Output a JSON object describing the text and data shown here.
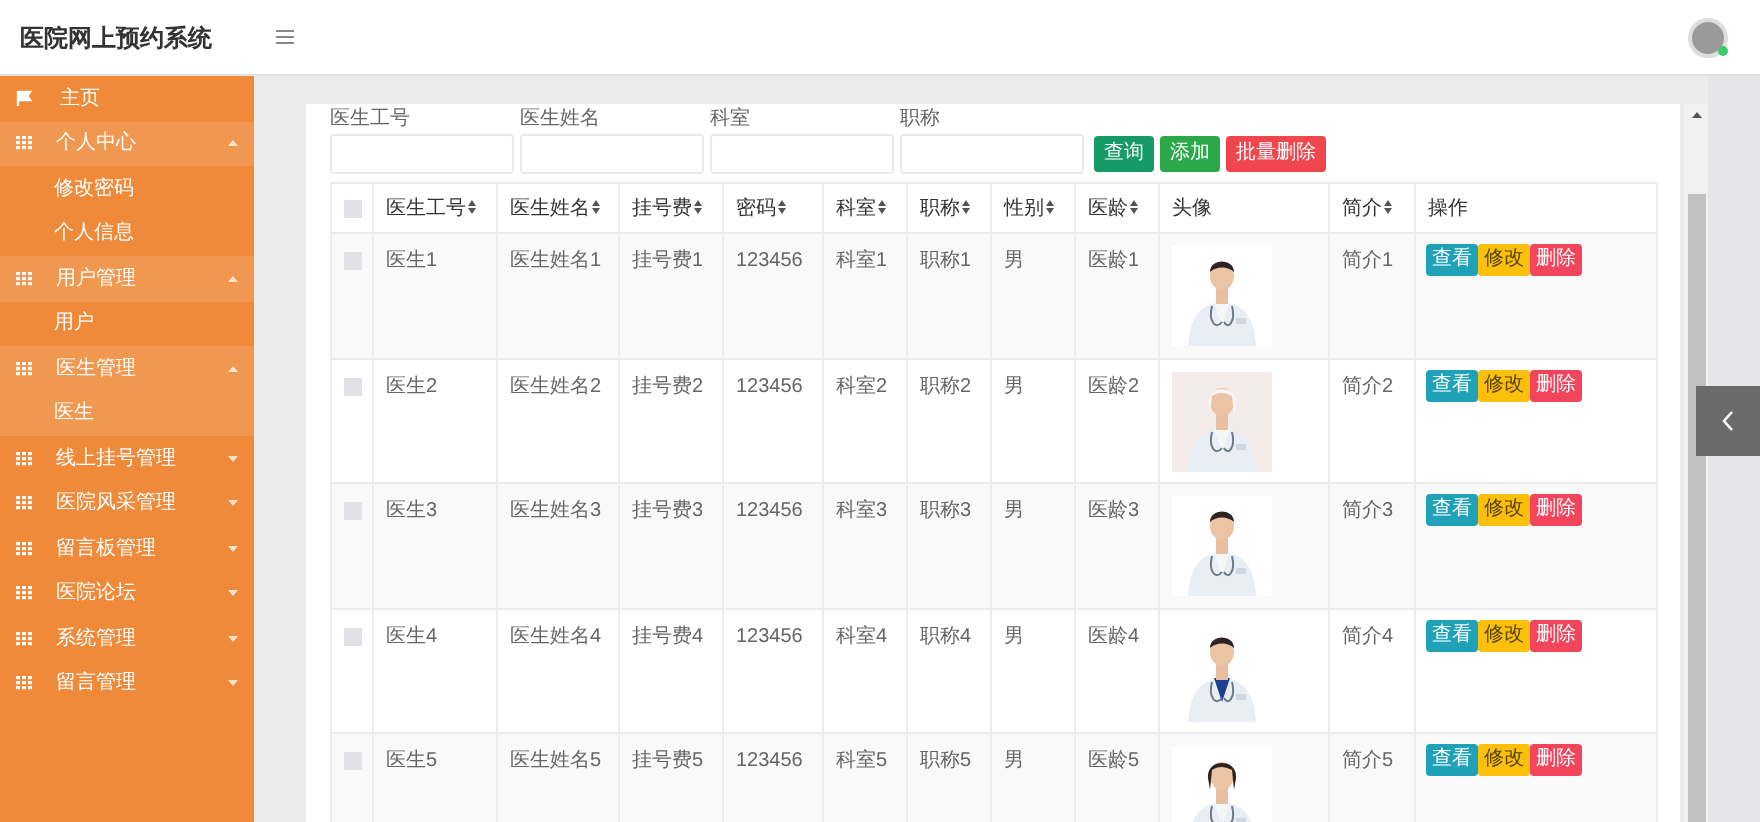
{
  "header": {
    "title": "医院网上预约系统"
  },
  "sidebar": {
    "items": [
      {
        "kind": "home",
        "label": "主页",
        "selected": false
      },
      {
        "kind": "group",
        "label": "个人中心",
        "expanded": true,
        "children": [
          {
            "label": "修改密码",
            "selected": false
          },
          {
            "label": "个人信息",
            "selected": false
          }
        ]
      },
      {
        "kind": "group",
        "label": "用户管理",
        "expanded": true,
        "children": [
          {
            "label": "用户",
            "selected": false
          }
        ]
      },
      {
        "kind": "group",
        "label": "医生管理",
        "expanded": true,
        "children": [
          {
            "label": "医生",
            "selected": true
          }
        ]
      },
      {
        "kind": "group",
        "label": "线上挂号管理",
        "expanded": false
      },
      {
        "kind": "group",
        "label": "医院风采管理",
        "expanded": false
      },
      {
        "kind": "group",
        "label": "留言板管理",
        "expanded": false
      },
      {
        "kind": "group",
        "label": "医院论坛",
        "expanded": false
      },
      {
        "kind": "group",
        "label": "系统管理",
        "expanded": false
      },
      {
        "kind": "group",
        "label": "留言管理",
        "expanded": false
      }
    ]
  },
  "search": {
    "fields": [
      {
        "label": "医生工号"
      },
      {
        "label": "医生姓名"
      },
      {
        "label": "科室"
      },
      {
        "label": "职称"
      }
    ],
    "buttons": [
      {
        "label": "查询",
        "kind": "search"
      },
      {
        "label": "添加",
        "kind": "add"
      },
      {
        "label": "批量删除",
        "kind": "delete"
      }
    ]
  },
  "table": {
    "select_all": {
      "checked": false
    },
    "columns": [
      {
        "label": "医生工号",
        "sortable": true
      },
      {
        "label": "医生姓名",
        "sortable": true
      },
      {
        "label": "挂号费",
        "sortable": true
      },
      {
        "label": "密码",
        "sortable": true
      },
      {
        "label": "科室",
        "sortable": true
      },
      {
        "label": "职称",
        "sortable": true
      },
      {
        "label": "性别",
        "sortable": true
      },
      {
        "label": "医龄",
        "sortable": true
      },
      {
        "label": "头像",
        "sortable": false
      },
      {
        "label": "简介",
        "sortable": true
      },
      {
        "label": "操作",
        "sortable": false
      }
    ],
    "rows": [
      {
        "checked": false,
        "cells": [
          "医生1",
          "医生姓名1",
          "挂号费1",
          "123456",
          "科室1",
          "职称1",
          "男",
          "医龄1"
        ],
        "photo": {
          "kind": "picture"
        },
        "intro": "简介1",
        "actions": [
          {
            "label": "查看",
            "kind": "view"
          },
          {
            "label": "修改",
            "kind": "edit"
          },
          {
            "label": "删除",
            "kind": "delete"
          }
        ]
      },
      {
        "checked": false,
        "cells": [
          "医生2",
          "医生姓名2",
          "挂号费2",
          "123456",
          "科室2",
          "职称2",
          "男",
          "医龄2"
        ],
        "photo": {
          "kind": "picture"
        },
        "intro": "简介2",
        "actions": [
          {
            "label": "查看",
            "kind": "view"
          },
          {
            "label": "修改",
            "kind": "edit"
          },
          {
            "label": "删除",
            "kind": "delete"
          }
        ]
      },
      {
        "checked": false,
        "cells": [
          "医生3",
          "医生姓名3",
          "挂号费3",
          "123456",
          "科室3",
          "职称3",
          "男",
          "医龄3"
        ],
        "photo": {
          "kind": "picture"
        },
        "intro": "简介3",
        "actions": [
          {
            "label": "查看",
            "kind": "view"
          },
          {
            "label": "修改",
            "kind": "edit"
          },
          {
            "label": "删除",
            "kind": "delete"
          }
        ]
      },
      {
        "checked": false,
        "cells": [
          "医生4",
          "医生姓名4",
          "挂号费4",
          "123456",
          "科室4",
          "职称4",
          "男",
          "医龄4"
        ],
        "photo": {
          "kind": "picture"
        },
        "intro": "简介4",
        "actions": [
          {
            "label": "查看",
            "kind": "view"
          },
          {
            "label": "修改",
            "kind": "edit"
          },
          {
            "label": "删除",
            "kind": "delete"
          }
        ]
      },
      {
        "checked": false,
        "cells": [
          "医生5",
          "医生姓名5",
          "挂号费5",
          "123456",
          "科室5",
          "职称5",
          "男",
          "医龄5"
        ],
        "photo": {
          "kind": "picture"
        },
        "intro": "简介5",
        "actions": [
          {
            "label": "查看",
            "kind": "view"
          },
          {
            "label": "修改",
            "kind": "edit"
          },
          {
            "label": "删除",
            "kind": "delete"
          }
        ]
      }
    ]
  }
}
